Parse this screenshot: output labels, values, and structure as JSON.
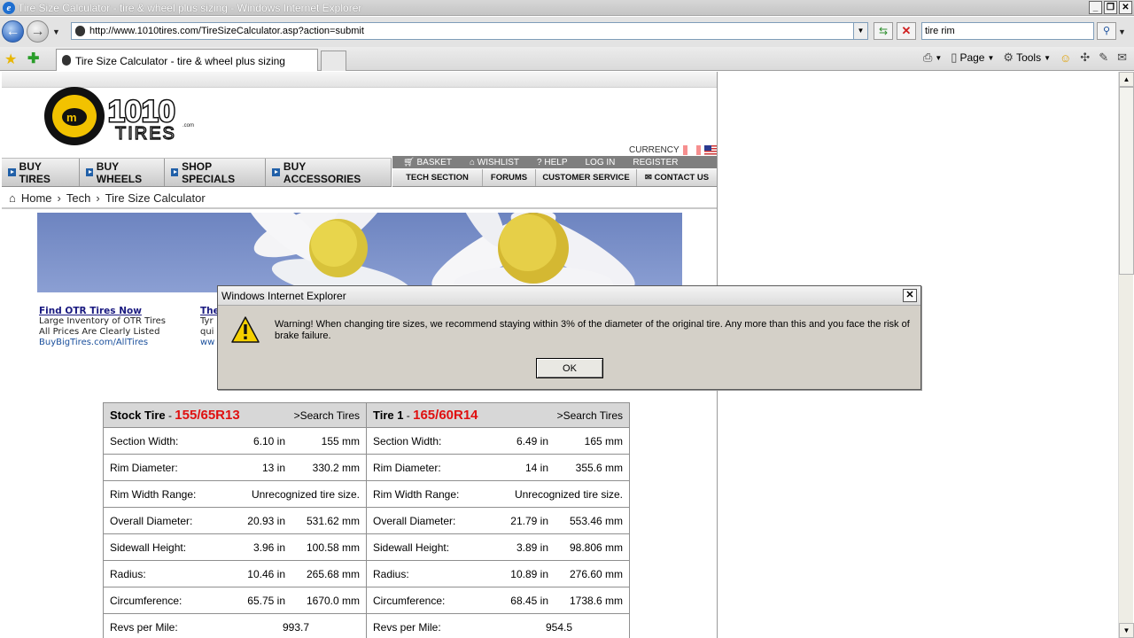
{
  "window": {
    "title": "Tire Size Calculator - tire & wheel plus sizing - Windows Internet Explorer"
  },
  "address": {
    "url": "http://www.1010tires.com/TireSizeCalculator.asp?action=submit"
  },
  "search": {
    "value": "tire rim"
  },
  "tab": {
    "label": "Tire Size Calculator - tire & wheel plus sizing"
  },
  "commandbar": {
    "page_label": "Page",
    "tools_label": "Tools"
  },
  "site": {
    "logo_text": "1010",
    "logo_sub": "TIRES",
    "logo_com": ".com",
    "currency_label": "CURRENCY",
    "nav": [
      {
        "label": "BUY TIRES"
      },
      {
        "label": "BUY WHEELS"
      },
      {
        "label": "SHOP SPECIALS"
      },
      {
        "label": "BUY ACCESSORIES"
      }
    ],
    "util": {
      "basket": "BASKET",
      "wishlist": "WISHLIST",
      "help": "HELP",
      "login": "LOG IN",
      "register": "REGISTER"
    },
    "subnav": {
      "tech": "TECH SECTION",
      "forums": "FORUMS",
      "customer": "CUSTOMER SERVICE",
      "contact": "CONTACT US"
    }
  },
  "breadcrumb": {
    "home": "Home",
    "tech": "Tech",
    "current": "Tire Size Calculator"
  },
  "ads": {
    "title1": "Find OTR Tires Now",
    "line1a": "Large Inventory of OTR Tires",
    "line1b": "All Prices Are Clearly Listed",
    "url1": "BuyBigTires.com/AllTires",
    "title2": "The",
    "line2a": "Tyr",
    "line2b": "qui",
    "url2": "ww"
  },
  "table": {
    "stock": {
      "title": "Stock Tire",
      "dash": " - ",
      "size": "155/65R13",
      "search": ">Search Tires"
    },
    "tire1": {
      "title": "Tire 1",
      "dash": " - ",
      "size": "165/60R14",
      "search": ">Search Tires"
    },
    "rows": {
      "section_width": {
        "label": "Section Width:",
        "s1": "6.10 in",
        "s2": "155 mm",
        "t1": "6.49 in",
        "t2": "165 mm"
      },
      "rim_diameter": {
        "label": "Rim Diameter:",
        "s1": "13 in",
        "s2": "330.2 mm",
        "t1": "14 in",
        "t2": "355.6 mm"
      },
      "rim_width": {
        "label": "Rim Width Range:",
        "s": "Unrecognized tire size.",
        "t": "Unrecognized tire size."
      },
      "overall_diameter": {
        "label": "Overall Diameter:",
        "s1": "20.93 in",
        "s2": "531.62 mm",
        "t1": "21.79 in",
        "t2": "553.46 mm"
      },
      "sidewall_height": {
        "label": "Sidewall Height:",
        "s1": "3.96 in",
        "s2": "100.58 mm",
        "t1": "3.89 in",
        "t2": "98.806 mm"
      },
      "radius": {
        "label": "Radius:",
        "s1": "10.46 in",
        "s2": "265.68 mm",
        "t1": "10.89 in",
        "t2": "276.60 mm"
      },
      "circumference": {
        "label": "Circumference:",
        "s1": "65.75 in",
        "s2": "1670.0 mm",
        "t1": "68.45 in",
        "t2": "1738.6 mm"
      },
      "revs": {
        "label": "Revs per Mile:",
        "s": "993.7",
        "t": "954.5"
      }
    }
  },
  "dialog": {
    "title": "Windows Internet Explorer",
    "message": "Warning! When changing tire sizes, we recommend staying within 3% of the diameter of the original tire.  Any more than this and you face the risk of brake failure.",
    "ok_label": "OK"
  }
}
